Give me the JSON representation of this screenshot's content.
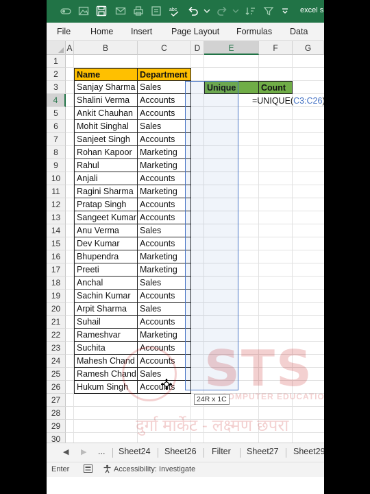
{
  "titlebar": {
    "title": "excel sl",
    "icons": [
      "autosave-icon",
      "save-icon",
      "print-preview-icon",
      "quick-print-icon",
      "spell-check-icon",
      "undo-icon",
      "redo-icon",
      "sort-icon",
      "filter-icon"
    ],
    "color": "#217346"
  },
  "ribbon": {
    "tabs": [
      "File",
      "Home",
      "Insert",
      "Page Layout",
      "Formulas",
      "Data"
    ]
  },
  "grid": {
    "columns": [
      "A",
      "B",
      "C",
      "D",
      "E",
      "F",
      "G"
    ],
    "selected_column": "E",
    "rows": [
      "1",
      "2",
      "3",
      "4",
      "5",
      "6",
      "7",
      "8",
      "9",
      "10",
      "11",
      "12",
      "13",
      "14",
      "15",
      "16",
      "17",
      "18",
      "19",
      "20",
      "21",
      "22",
      "23",
      "24",
      "25",
      "26",
      "27",
      "28",
      "29",
      "30"
    ],
    "selected_row": "4"
  },
  "table": {
    "headers": [
      "Name",
      "Department"
    ],
    "rows": [
      [
        "Sanjay Sharma",
        "Sales"
      ],
      [
        "Shalini Verma",
        "Accounts"
      ],
      [
        "Ankit Chauhan",
        "Accounts"
      ],
      [
        "Mohit Singhal",
        "Sales"
      ],
      [
        "Sanjeet Singh",
        "Accounts"
      ],
      [
        "Rohan Kapoor",
        "Marketing"
      ],
      [
        "Rahul",
        "Marketing"
      ],
      [
        "Anjali",
        "Accounts"
      ],
      [
        "Ragini Sharma",
        "Marketing"
      ],
      [
        "Pratap Singh",
        "Accounts"
      ],
      [
        "Sangeet Kumar",
        "Accounts"
      ],
      [
        "Anu Verma",
        "Sales"
      ],
      [
        "Dev Kumar",
        "Accounts"
      ],
      [
        "Bhupendra",
        "Marketing"
      ],
      [
        "Preeti",
        "Marketing"
      ],
      [
        "Anchal",
        "Sales"
      ],
      [
        "Sachin Kumar",
        "Accounts"
      ],
      [
        "Arpit Sharma",
        "Sales"
      ],
      [
        "Suhail",
        "Accounts"
      ],
      [
        "Rameshvar",
        "Marketing"
      ],
      [
        "Suchita",
        "Accounts"
      ],
      [
        "Mahesh Chand",
        "Accounts"
      ],
      [
        "Ramesh Chand",
        "Sales"
      ],
      [
        "Hukum Singh",
        "Accounts"
      ]
    ],
    "header_color": "#ffc000"
  },
  "summary": {
    "headers": [
      "Unique",
      "Count"
    ],
    "header_color": "#70ad47",
    "formula_prefix": "=UNIQUE(",
    "formula_ref": "C3:C26",
    "formula_suffix": ")"
  },
  "tooltip": "24R x 1C",
  "watermark": {
    "big": "STS",
    "line1": "COMPUTER EDUCATION",
    "line2": "दुर्गा मार्केट - लक्ष्मण छपरा"
  },
  "sheets": {
    "nav_prev": "◀",
    "nav_next": "▶",
    "more": "...",
    "tabs": [
      "Sheet24",
      "Sheet26",
      "Filter",
      "Sheet27",
      "Sheet29"
    ]
  },
  "status": {
    "mode": "Enter",
    "accessibility": "Accessibility: Investigate"
  }
}
